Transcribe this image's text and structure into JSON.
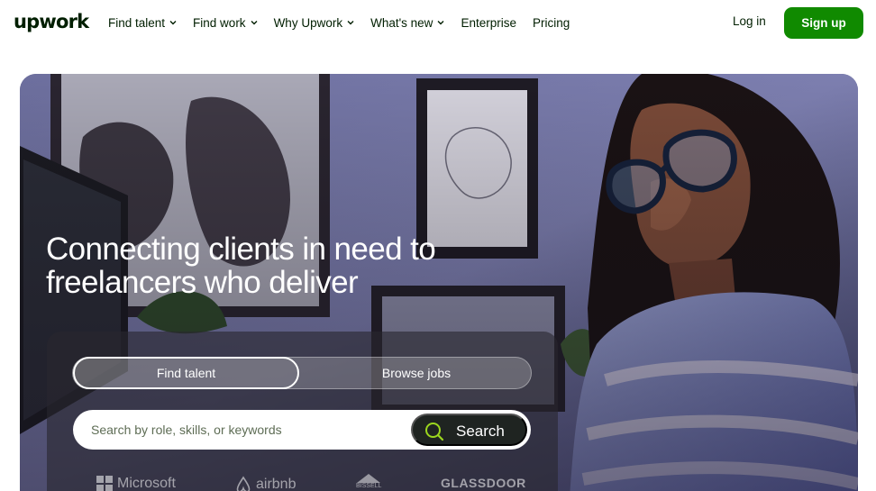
{
  "header": {
    "logo": "upwork",
    "menu": [
      {
        "label": "Find talent",
        "dropdown": true
      },
      {
        "label": "Find work",
        "dropdown": true
      },
      {
        "label": "Why Upwork",
        "dropdown": true
      },
      {
        "label": "What's new",
        "dropdown": true
      },
      {
        "label": "Enterprise",
        "dropdown": false
      },
      {
        "label": "Pricing",
        "dropdown": false
      }
    ],
    "login": "Log in",
    "signup": "Sign up"
  },
  "hero": {
    "headline_line1": "Connecting clients in need to",
    "headline_line2": "freelancers who deliver",
    "tabs": {
      "active": "Find talent",
      "inactive": "Browse jobs"
    },
    "search": {
      "placeholder": "Search by role, skills, or keywords",
      "value": "",
      "button": "Search"
    },
    "trusted_logos": [
      "Microsoft",
      "airbnb",
      "BISSELL",
      "GLASSDOOR"
    ]
  },
  "colors": {
    "brand_green": "#108a00",
    "text_dark": "#001e00",
    "search_button": "#1f2421"
  }
}
